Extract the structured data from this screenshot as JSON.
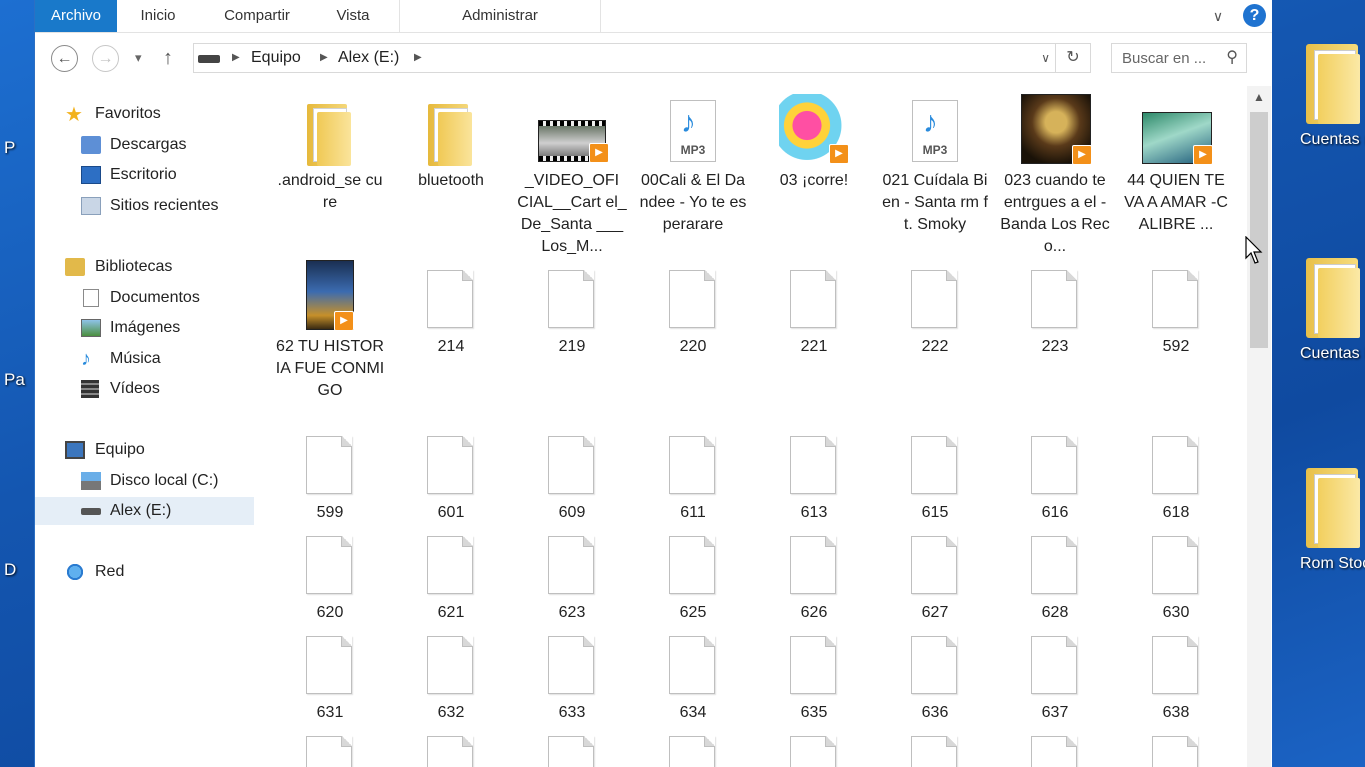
{
  "ribbon": {
    "tabs": [
      "Archivo",
      "Inicio",
      "Compartir",
      "Vista",
      "Administrar"
    ],
    "help": "?"
  },
  "navbar": {
    "breadcrumb": [
      "Equipo",
      "Alex (E:)"
    ],
    "search_placeholder": "Buscar en ..."
  },
  "navpane": {
    "favorites": "Favoritos",
    "fav_items": [
      "Descargas",
      "Escritorio",
      "Sitios recientes"
    ],
    "libraries": "Bibliotecas",
    "lib_items": [
      "Documentos",
      "Imágenes",
      "Música",
      "Vídeos"
    ],
    "computer": "Equipo",
    "comp_items": [
      "Disco local (C:)",
      "Alex (E:)"
    ],
    "network": "Red"
  },
  "files": [
    {
      "name": ".android_se cure",
      "type": "folder"
    },
    {
      "name": "bluetooth",
      "type": "folder"
    },
    {
      "name": "_VIDEO_OFI CIAL__Cart el_De_Santa ___Los_M...",
      "type": "video"
    },
    {
      "name": "00Cali & El Dandee - Yo te esperarare",
      "type": "mp3"
    },
    {
      "name": "03 ¡corre!",
      "type": "album-pink"
    },
    {
      "name": "021 Cuídala Bien  - Santa rm ft. Smoky",
      "type": "mp3"
    },
    {
      "name": "023 cuando te entrgues a el - Banda Los Reco...",
      "type": "album-dark"
    },
    {
      "name": "44 QUIEN TE VA A AMAR -CALIBRE ...",
      "type": "album-green"
    },
    {
      "name": "62 TU HISTORIA FUE CONMIGO",
      "type": "album-blue"
    },
    {
      "name": "214",
      "type": "file"
    },
    {
      "name": "219",
      "type": "file"
    },
    {
      "name": "220",
      "type": "file"
    },
    {
      "name": "221",
      "type": "file"
    },
    {
      "name": "222",
      "type": "file"
    },
    {
      "name": "223",
      "type": "file"
    },
    {
      "name": "592",
      "type": "file"
    },
    {
      "name": "599",
      "type": "file"
    },
    {
      "name": "601",
      "type": "file"
    },
    {
      "name": "609",
      "type": "file"
    },
    {
      "name": "611",
      "type": "file"
    },
    {
      "name": "613",
      "type": "file"
    },
    {
      "name": "615",
      "type": "file"
    },
    {
      "name": "616",
      "type": "file"
    },
    {
      "name": "618",
      "type": "file"
    },
    {
      "name": "620",
      "type": "file"
    },
    {
      "name": "621",
      "type": "file"
    },
    {
      "name": "623",
      "type": "file"
    },
    {
      "name": "625",
      "type": "file"
    },
    {
      "name": "626",
      "type": "file"
    },
    {
      "name": "627",
      "type": "file"
    },
    {
      "name": "628",
      "type": "file"
    },
    {
      "name": "630",
      "type": "file"
    },
    {
      "name": "631",
      "type": "file"
    },
    {
      "name": "632",
      "type": "file"
    },
    {
      "name": "633",
      "type": "file"
    },
    {
      "name": "634",
      "type": "file"
    },
    {
      "name": "635",
      "type": "file"
    },
    {
      "name": "636",
      "type": "file"
    },
    {
      "name": "637",
      "type": "file"
    },
    {
      "name": "638",
      "type": "file"
    },
    {
      "name": "",
      "type": "file"
    },
    {
      "name": "",
      "type": "file"
    },
    {
      "name": "",
      "type": "file"
    },
    {
      "name": "",
      "type": "file"
    },
    {
      "name": "",
      "type": "file"
    },
    {
      "name": "",
      "type": "file"
    },
    {
      "name": "",
      "type": "file"
    },
    {
      "name": "",
      "type": "file"
    }
  ],
  "desktop_icons": [
    "Cuentas regaladas",
    "Cuentas Premium p",
    "Rom Stock Samsung G"
  ],
  "desktop_left_letters": [
    "P",
    "Pa",
    "D"
  ]
}
